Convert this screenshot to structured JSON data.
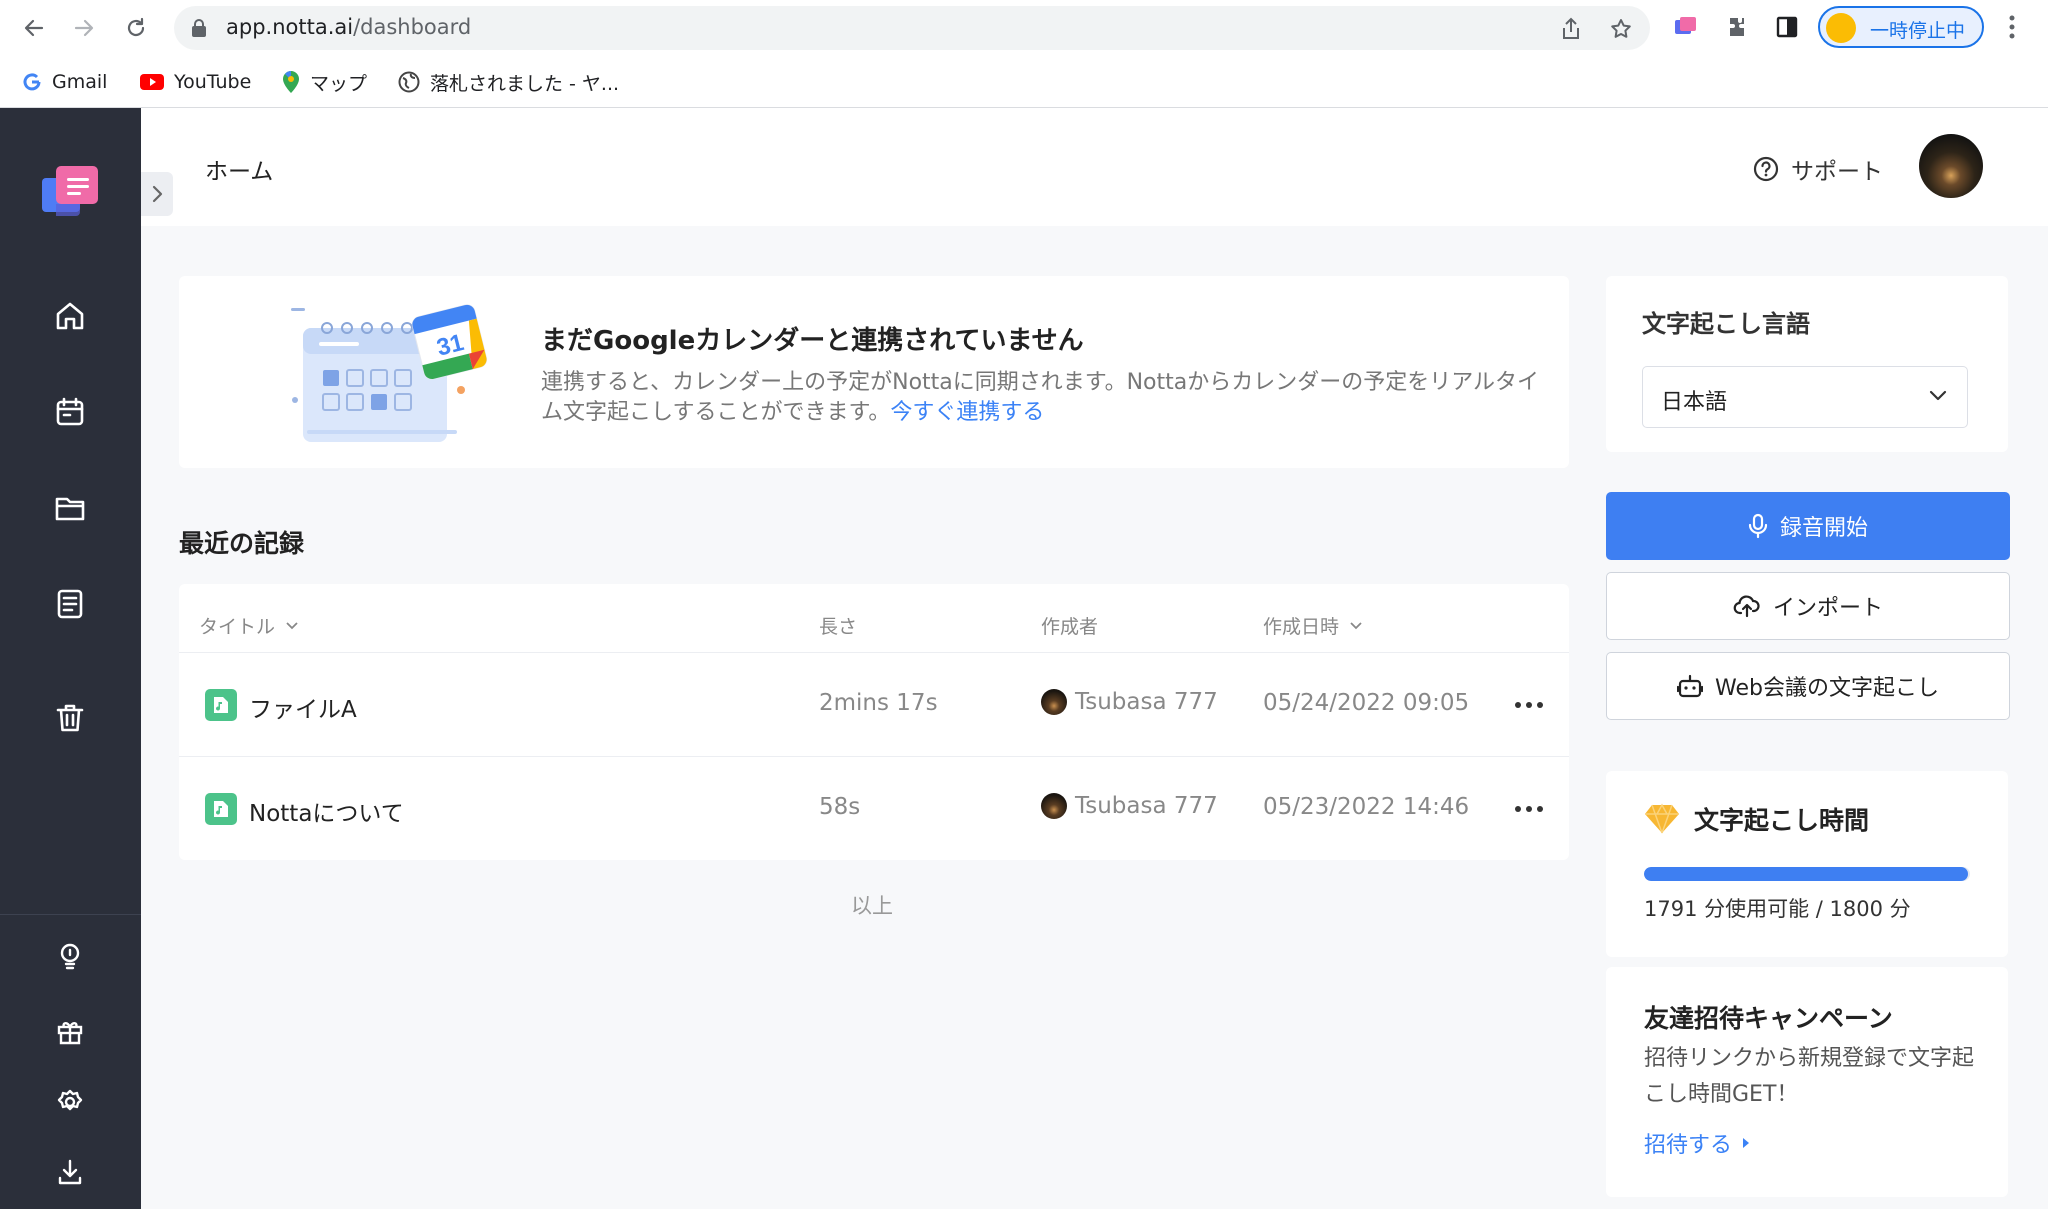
{
  "browser": {
    "url_host": "app.notta.ai",
    "url_path": "/dashboard",
    "profile_status": "一時停止中",
    "bookmarks": [
      {
        "label": "Gmail",
        "icon": "gmail-icon"
      },
      {
        "label": "YouTube",
        "icon": "youtube-icon"
      },
      {
        "label": "マップ",
        "icon": "maps-icon"
      },
      {
        "label": "落札されました - ヤ...",
        "icon": "globe-icon"
      }
    ]
  },
  "header": {
    "page_title": "ホーム",
    "support_label": "サポート"
  },
  "calendar_banner": {
    "title": "まだGoogleカレンダーと連携されていません",
    "description": "連携すると、カレンダー上の予定がNottaに同期されます。Nottaからカレンダーの予定をリアルタイム文字起こしすることができます。",
    "link_label": "今すぐ連携する",
    "calendar_number": "31"
  },
  "recent": {
    "section_title": "最近の記録",
    "columns": {
      "title": "タイトル",
      "length": "長さ",
      "author": "作成者",
      "created": "作成日時"
    },
    "rows": [
      {
        "title": "ファイルA",
        "length": "2mins 17s",
        "author": "Tsubasa 777",
        "created": "05/24/2022 09:05"
      },
      {
        "title": "Nottaについて",
        "length": "58s",
        "author": "Tsubasa 777",
        "created": "05/23/2022 14:46"
      }
    ],
    "end_label": "以上"
  },
  "right_panel": {
    "language": {
      "label": "文字起こし言語",
      "selected": "日本語"
    },
    "buttons": {
      "record": "録音開始",
      "import": "インポート",
      "web_meeting": "Web会議の文字起こし"
    },
    "transcription_time": {
      "title": "文字起こし時間",
      "usage_text": "1791 分使用可能 / 1800 分",
      "remaining_fraction": 0.995
    },
    "invite": {
      "title": "友達招待キャンペーン",
      "description": "招待リンクから新規登録で文字起こし時間GET！",
      "link_label": "招待する"
    }
  },
  "colors": {
    "sidebar_bg": "#2b2f3a",
    "primary": "#3e7ff2",
    "link": "#3b82f6",
    "file_icon": "#4cc38a"
  }
}
